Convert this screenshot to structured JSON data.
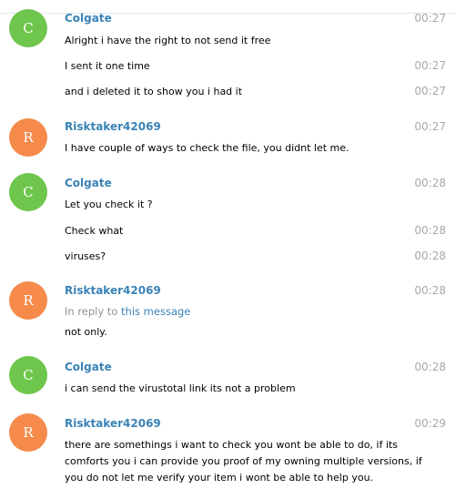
{
  "colors": {
    "colgate_avatar": "#6ec64c",
    "risktaker_avatar": "#f58a4b",
    "sender_name": "#3a83b6",
    "timestamp": "#a5a8ab",
    "reply_link": "#3a83b6"
  },
  "messages": [
    {
      "sender": "Colgate",
      "initial": "C",
      "time": "00:27",
      "text": "Alright i have the right to not send it free"
    },
    {
      "time": "00:27",
      "text": "I sent it one time"
    },
    {
      "time": "00:27",
      "text": "and i deleted it to show you i had it"
    },
    {
      "sender": "Risktaker42069",
      "initial": "R",
      "time": "00:27",
      "text": "I have couple of ways to check the file, you didnt let me."
    },
    {
      "sender": "Colgate",
      "initial": "C",
      "time": "00:28",
      "text": "Let you check it ?"
    },
    {
      "time": "00:28",
      "text": "Check what"
    },
    {
      "time": "00:28",
      "text": "viruses?"
    },
    {
      "sender": "Risktaker42069",
      "initial": "R",
      "time": "00:28",
      "reply_prefix": "In reply to",
      "reply_link": "this message",
      "text": "not only."
    },
    {
      "sender": "Colgate",
      "initial": "C",
      "time": "00:28",
      "text": "i can send the virustotal link its not a problem"
    },
    {
      "sender": "Risktaker42069",
      "initial": "R",
      "time": "00:29",
      "text_lines": [
        "there are somethings i want to check you wont be able to do, if its",
        "comforts you i can provide you proof of my owning multiple versions, if",
        "you do not let me verify your item i wont be able to help you."
      ]
    }
  ]
}
